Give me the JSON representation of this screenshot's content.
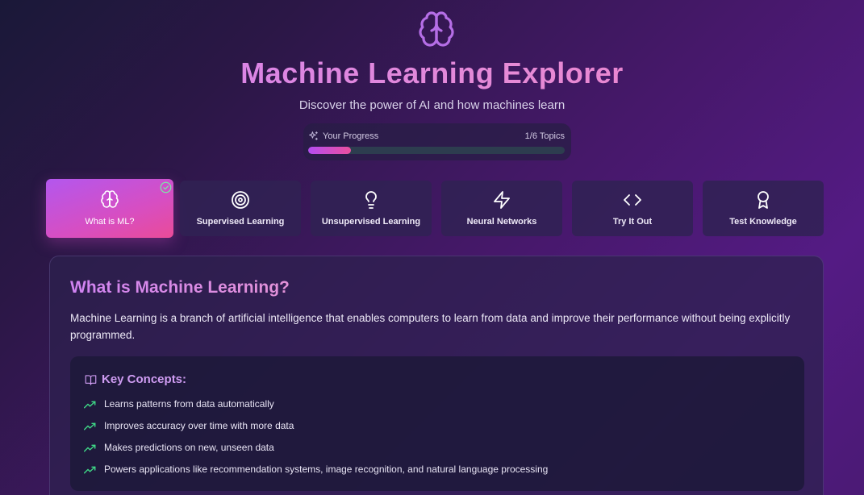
{
  "header": {
    "logo_icon": "brain-icon",
    "title": "Machine Learning Explorer",
    "subtitle": "Discover the power of AI and how machines learn"
  },
  "progress": {
    "icon": "sparkles-icon",
    "label": "Your Progress",
    "count": "1/6 Topics",
    "fraction": 0.167
  },
  "tabs": [
    {
      "label": "What is ML?",
      "icon": "brain-icon",
      "active": true,
      "completed": true
    },
    {
      "label": "Supervised Learning",
      "icon": "target-icon",
      "active": false
    },
    {
      "label": "Unsupervised Learning",
      "icon": "lightbulb-icon",
      "active": false
    },
    {
      "label": "Neural Networks",
      "icon": "lightning-icon",
      "active": false
    },
    {
      "label": "Try It Out",
      "icon": "code-icon",
      "active": false
    },
    {
      "label": "Test Knowledge",
      "icon": "award-icon",
      "active": false
    }
  ],
  "panel": {
    "title": "What is Machine Learning?",
    "description": "Machine Learning is a branch of artificial intelligence that enables computers to learn from data and improve their performance without being explicitly programmed.",
    "concepts_icon": "book-open-icon",
    "concepts_title": "Key Concepts:",
    "concepts": [
      "Learns patterns from data automatically",
      "Improves accuracy over time with more data",
      "Makes predictions on new, unseen data",
      "Powers applications like recommendation systems, image recognition, and natural language processing"
    ]
  },
  "colors": {
    "accent_purple": "#b357ee",
    "accent_pink": "#ea4b98",
    "trend_green": "#3fd987",
    "check_green": "#7ee6a8"
  }
}
